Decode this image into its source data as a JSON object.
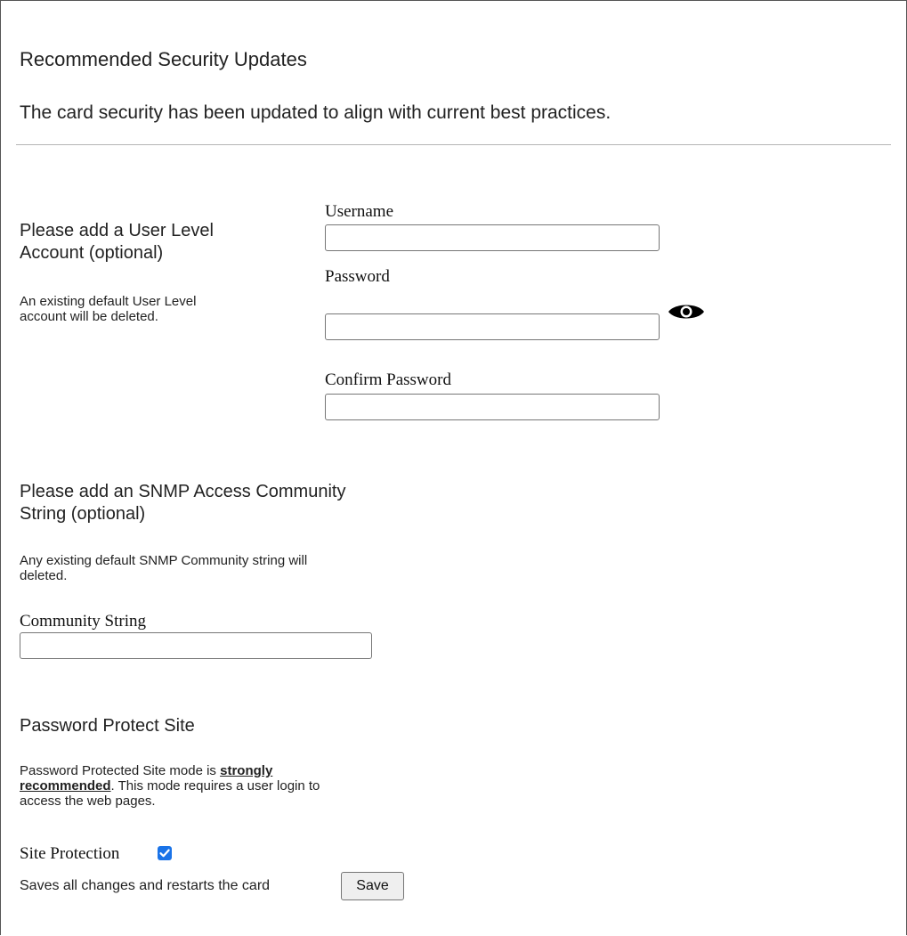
{
  "header": {
    "title": "Recommended Security Updates",
    "subtitle": "The card security has been updated to align with current best practices."
  },
  "user_account": {
    "heading_line1": "Please add a User Level",
    "heading_line2": "Account (optional)",
    "note_line1": "An existing default User Level",
    "note_line2": "account will be deleted.",
    "username_label": "Username",
    "username_value": "",
    "password_label": "Password",
    "password_value": "",
    "confirm_label": "Confirm Password",
    "confirm_value": "",
    "show_password_icon": "eye-icon"
  },
  "snmp": {
    "heading_line1": "Please add an SNMP Access Community",
    "heading_line2": "String (optional)",
    "note_line1": "Any existing default SNMP Community string will",
    "note_line2": "deleted.",
    "community_label": "Community String",
    "community_value": ""
  },
  "protect": {
    "heading": "Password Protect Site",
    "note_prefix": "Password Protected Site mode is ",
    "note_strong_1": "strongly",
    "note_strong_2": "recommended",
    "note_suffix_1": ". This mode requires a user login to",
    "note_line3": "access the web pages.",
    "site_protection_label": "Site Protection",
    "site_protection_checked": true,
    "checkbox_color": "#1a73e8"
  },
  "footer": {
    "save_note": "Saves all changes and restarts the card",
    "save_label": "Save"
  }
}
